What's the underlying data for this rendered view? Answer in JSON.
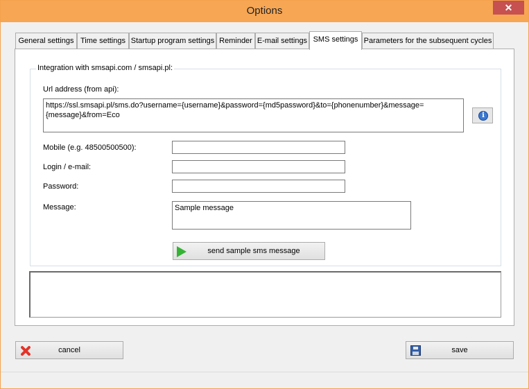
{
  "window": {
    "title": "Options"
  },
  "tabs": [
    {
      "label": "General settings",
      "active": false
    },
    {
      "label": "Time settings",
      "active": false
    },
    {
      "label": "Startup program settings",
      "active": false
    },
    {
      "label": "Reminder",
      "active": false
    },
    {
      "label": "E-mail settings",
      "active": false
    },
    {
      "label": "SMS settings",
      "active": true
    },
    {
      "label": "Parameters for the subsequent cycles",
      "active": false
    }
  ],
  "sms": {
    "group_title": "Integration with smsapi.com / smsapi.pl:",
    "url_label": "Url address (from api):",
    "url_value": "https://ssl.smsapi.pl/sms.do?username={username}&password={md5password}&to={phonenumber}&message={message}&from=Eco",
    "mobile_label": "Mobile (e.g. 48500500500):",
    "mobile_value": "",
    "login_label": "Login / e-mail:",
    "login_value": "",
    "password_label": "Password:",
    "password_value": "",
    "message_label": "Message:",
    "message_value": "Sample message",
    "send_button_label": "send sample sms message"
  },
  "footer": {
    "cancel_label": "cancel",
    "save_label": "save"
  },
  "icons": {
    "close": "close-icon",
    "info": "info-icon",
    "play": "play-icon",
    "cancel": "red-x-icon",
    "save": "floppy-disk-icon"
  },
  "colors": {
    "titlebar": "#f7a654",
    "close_button": "#c75050",
    "play_green": "#35b335",
    "cancel_red": "#e2342a"
  }
}
